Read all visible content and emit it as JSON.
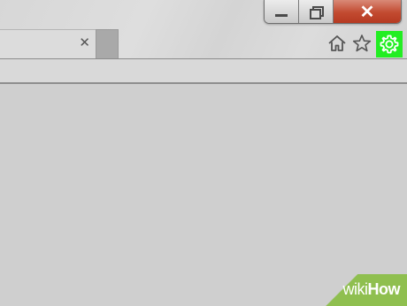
{
  "window_controls": {
    "minimize_icon": "minimize-icon",
    "restore_icon": "restore-icon",
    "close_glyph": "✕"
  },
  "tabs": [
    {
      "label": "",
      "close_glyph": "✕"
    }
  ],
  "toolbar": {
    "home_icon": "home-icon",
    "favorites_icon": "star-icon",
    "settings_icon": "gear-icon",
    "highlight_color": "#22ee22"
  },
  "watermark": {
    "text_regular": "wiki",
    "text_bold": "How"
  },
  "colors": {
    "close_button": "#c24a30",
    "background": "#d0d0d0"
  }
}
